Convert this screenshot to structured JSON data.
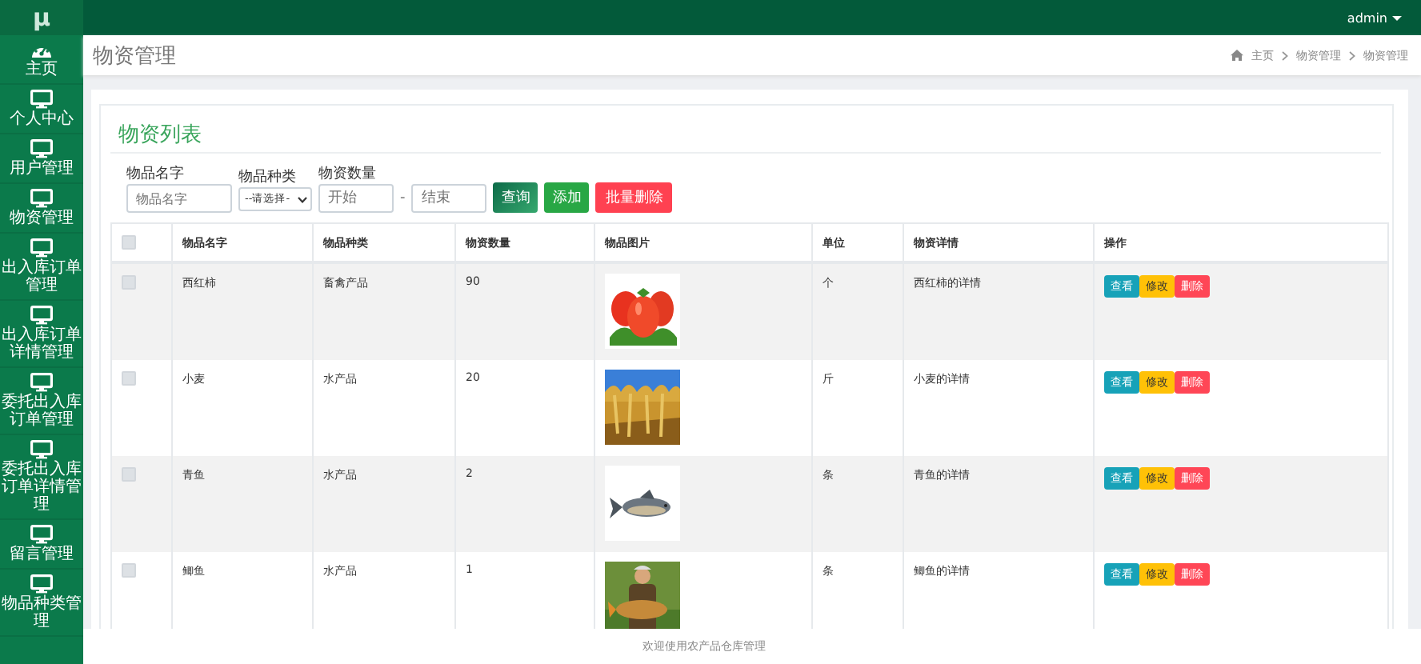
{
  "topbar": {
    "logo": "μ",
    "user": "admin"
  },
  "sidebar": {
    "items": [
      {
        "label": "主页",
        "kind": "dashboard"
      },
      {
        "label": "个人中心",
        "kind": "monitor"
      },
      {
        "label": "用户管理",
        "kind": "monitor"
      },
      {
        "label": "物资管理",
        "kind": "monitor"
      },
      {
        "label": "出入库订单管理",
        "kind": "monitor"
      },
      {
        "label": "出入库订单详情管理",
        "kind": "monitor"
      },
      {
        "label": "委托出入库订单管理",
        "kind": "monitor"
      },
      {
        "label": "委托出入库订单详情管理",
        "kind": "monitor"
      },
      {
        "label": "留言管理",
        "kind": "monitor"
      },
      {
        "label": "物品种类管理",
        "kind": "monitor"
      }
    ]
  },
  "header": {
    "title": "物资管理",
    "breadcrumb": [
      "主页",
      "物资管理",
      "物资管理"
    ]
  },
  "card": {
    "title": "物资列表",
    "filters": {
      "name": {
        "label": "物品名字",
        "placeholder": "物品名字"
      },
      "type": {
        "label": "物品种类",
        "value": "--请选择-"
      },
      "quantity": {
        "label": "物资数量",
        "from_placeholder": "开始",
        "separator": "-",
        "to_placeholder": "结束"
      }
    },
    "buttons": [
      {
        "label": "查询",
        "kind": "search"
      },
      {
        "label": "添加",
        "kind": "add"
      },
      {
        "label": "批量删除",
        "kind": "delete"
      }
    ]
  },
  "table": {
    "select_all": {
      "checked": false
    },
    "columns": [
      "物品名字",
      "物品种类",
      "物资数量",
      "物品图片",
      "单位",
      "物资详情",
      "操作"
    ],
    "rows": [
      {
        "checked": false,
        "name": "西红柿",
        "type": "畜禽产品",
        "quantity": "90",
        "picture": {
          "kind": "picture"
        },
        "unit": "个",
        "detail": "西红柿的详情",
        "actions": [
          {
            "label": "查看",
            "kind": "view"
          },
          {
            "label": "修改",
            "kind": "edit"
          },
          {
            "label": "删除",
            "kind": "delete"
          }
        ]
      },
      {
        "checked": false,
        "name": "小麦",
        "type": "水产品",
        "quantity": "20",
        "picture": {
          "kind": "picture"
        },
        "unit": "斤",
        "detail": "小麦的详情",
        "actions": [
          {
            "label": "查看",
            "kind": "view"
          },
          {
            "label": "修改",
            "kind": "edit"
          },
          {
            "label": "删除",
            "kind": "delete"
          }
        ]
      },
      {
        "checked": false,
        "name": "青鱼",
        "type": "水产品",
        "quantity": "2",
        "picture": {
          "kind": "picture"
        },
        "unit": "条",
        "detail": "青鱼的详情",
        "actions": [
          {
            "label": "查看",
            "kind": "view"
          },
          {
            "label": "修改",
            "kind": "edit"
          },
          {
            "label": "删除",
            "kind": "delete"
          }
        ]
      },
      {
        "checked": false,
        "name": "鲫鱼",
        "type": "水产品",
        "quantity": "1",
        "picture": {
          "kind": "picture"
        },
        "unit": "条",
        "detail": "鲫鱼的详情",
        "actions": [
          {
            "label": "查看",
            "kind": "view"
          },
          {
            "label": "修改",
            "kind": "edit"
          },
          {
            "label": "删除",
            "kind": "delete"
          }
        ]
      }
    ]
  },
  "footer": {
    "text": "欢迎使用农产品仓库管理"
  }
}
